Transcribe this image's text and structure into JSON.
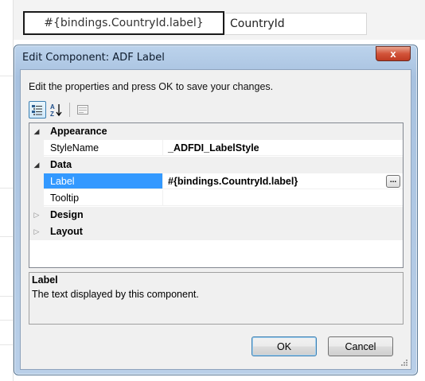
{
  "sheet": {
    "active_cell": "#{bindings.CountryId.label}",
    "next_cell": "CountryId"
  },
  "dialog": {
    "title": "Edit Component: ADF Label",
    "close_glyph": "x",
    "instruction": "Edit the properties and press OK to save your changes.",
    "toolbar": {
      "categorized_icon": "categorized-view-icon",
      "alphabetical_icon": "sort-az-icon",
      "pages_icon": "property-pages-icon"
    },
    "grid": {
      "categories": [
        {
          "name": "Appearance",
          "expanded": true
        },
        {
          "name": "Data",
          "expanded": true
        },
        {
          "name": "Design",
          "expanded": false
        },
        {
          "name": "Layout",
          "expanded": false
        }
      ],
      "properties": {
        "stylename": {
          "name": "StyleName",
          "value": "_ADFDI_LabelStyle"
        },
        "label": {
          "name": "Label",
          "value": "#{bindings.CountryId.label}",
          "selected": true
        },
        "tooltip": {
          "name": "Tooltip",
          "value": ""
        }
      },
      "ellipsis_label": "..."
    },
    "description": {
      "title": "Label",
      "text": "The text displayed by this component."
    },
    "buttons": {
      "ok": "OK",
      "cancel": "Cancel"
    }
  },
  "colors": {
    "selection": "#3399ff",
    "close_button": "#d2543a",
    "frame": "#bcd3ec"
  }
}
